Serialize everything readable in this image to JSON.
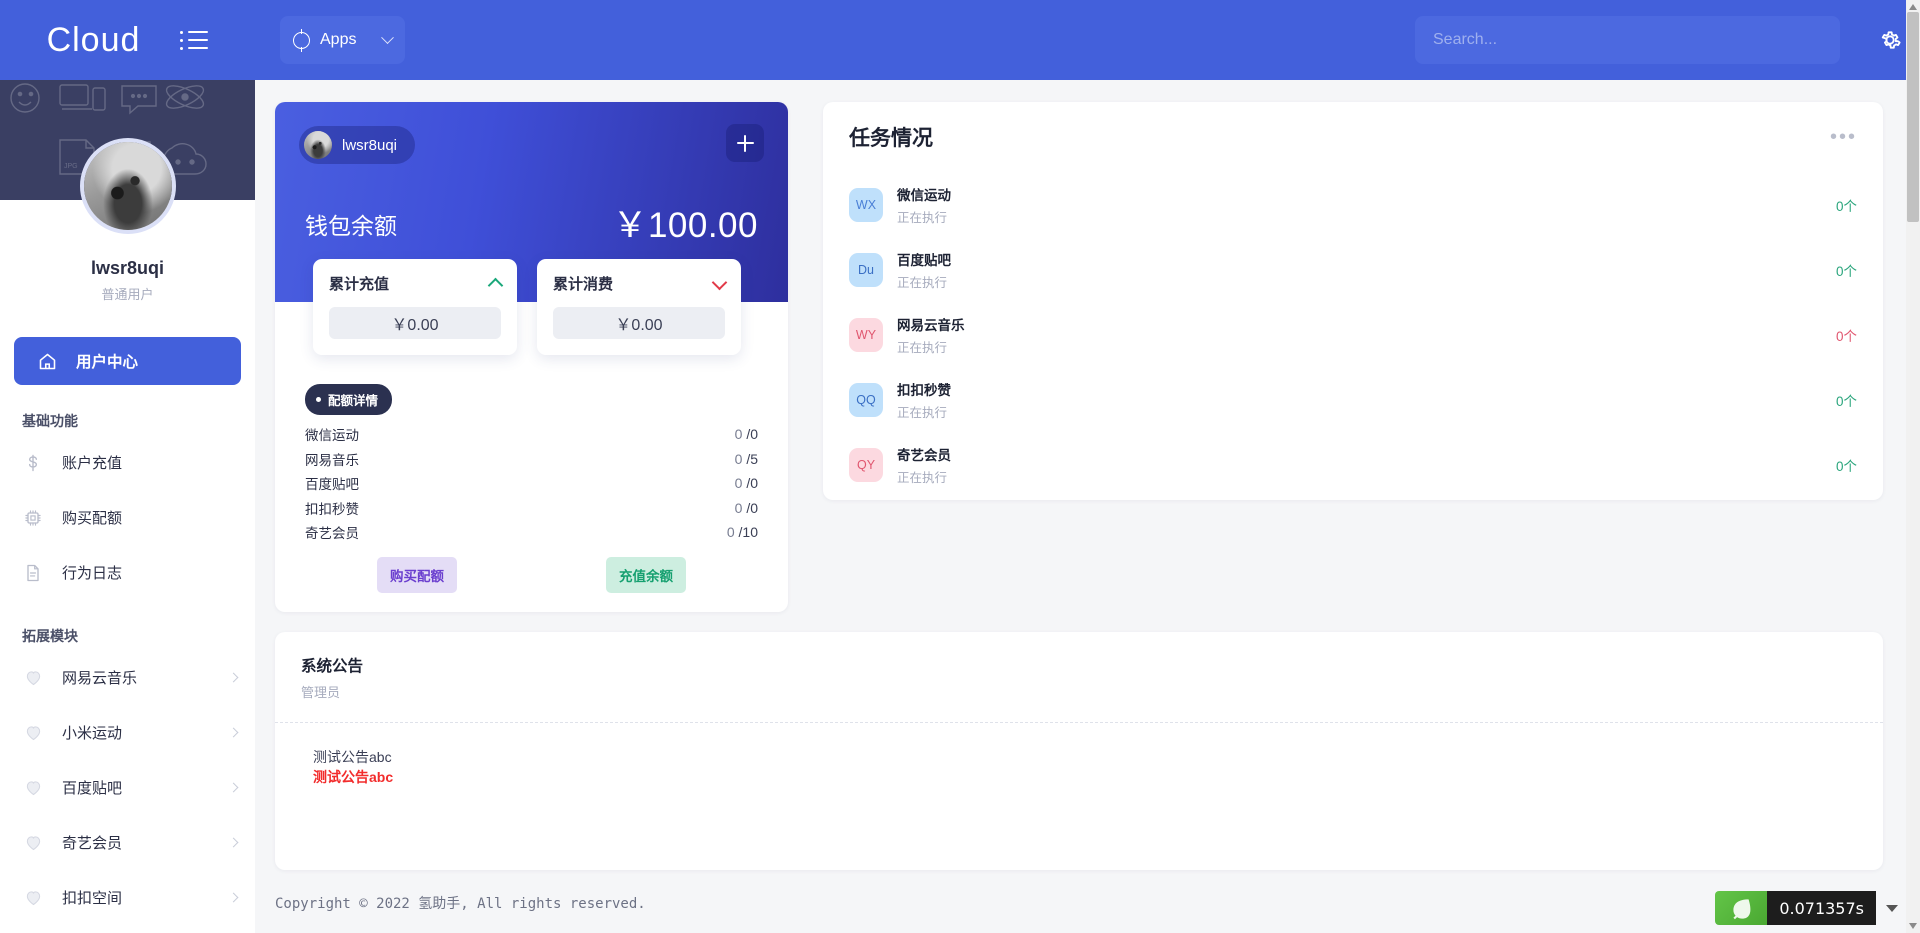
{
  "topbar": {
    "brand": "Cloud",
    "apps_label": "Apps",
    "search_placeholder": "Search..."
  },
  "sidebar": {
    "profile": {
      "name": "lwsr8uqi",
      "role": "普通用户"
    },
    "active_item": {
      "label": "用户中心",
      "icon": "home-icon"
    },
    "groups": [
      {
        "title": "基础功能",
        "items": [
          {
            "label": "账户充值",
            "icon": "dollar-icon"
          },
          {
            "label": "购买配额",
            "icon": "chip-icon"
          },
          {
            "label": "行为日志",
            "icon": "document-icon"
          }
        ]
      },
      {
        "title": "拓展模块",
        "items": [
          {
            "label": "网易云音乐",
            "icon": "heart-icon"
          },
          {
            "label": "小米运动",
            "icon": "heart-icon"
          },
          {
            "label": "百度贴吧",
            "icon": "heart-icon"
          },
          {
            "label": "奇艺会员",
            "icon": "heart-icon"
          },
          {
            "label": "扣扣空间",
            "icon": "heart-icon"
          }
        ]
      }
    ]
  },
  "wallet": {
    "user_chip": "lwsr8uqi",
    "balance_label": "钱包余额",
    "balance_amount": "￥100.00",
    "stats": [
      {
        "title": "累计充值",
        "value": "￥0.00",
        "trend": "up"
      },
      {
        "title": "累计消费",
        "value": "￥0.00",
        "trend": "down"
      }
    ],
    "quota_badge": "配额详情",
    "quota_rows": [
      {
        "name": "微信运动",
        "used": "0",
        "total": "/0"
      },
      {
        "name": "网易音乐",
        "used": "0",
        "total": "/5"
      },
      {
        "name": "百度贴吧",
        "used": "0",
        "total": "/0"
      },
      {
        "name": "扣扣秒赞",
        "used": "0",
        "total": "/0"
      },
      {
        "name": "奇艺会员",
        "used": "0",
        "total": "/10"
      }
    ],
    "buy_quota_label": "购买配额",
    "recharge_label": "充值余额"
  },
  "tasks": {
    "title": "任务情况",
    "rows": [
      {
        "initials": "WX",
        "name": "微信运动",
        "status": "正在执行",
        "count": "0个",
        "bg": "#bfe0fb",
        "fg": "#4a7fd6",
        "count_color": "#2aa57c"
      },
      {
        "initials": "Du",
        "name": "百度贴吧",
        "status": "正在执行",
        "count": "0个",
        "bg": "#bfe0fb",
        "fg": "#3a6fc4",
        "count_color": "#2aa57c"
      },
      {
        "initials": "WY",
        "name": "网易云音乐",
        "status": "正在执行",
        "count": "0个",
        "bg": "#fcd9e0",
        "fg": "#e0566f",
        "count_color": "#e0566f"
      },
      {
        "initials": "QQ",
        "name": "扣扣秒赞",
        "status": "正在执行",
        "count": "0个",
        "bg": "#bfe0fb",
        "fg": "#3a6fc4",
        "count_color": "#2aa57c"
      },
      {
        "initials": "QY",
        "name": "奇艺会员",
        "status": "正在执行",
        "count": "0个",
        "bg": "#fcd9e0",
        "fg": "#e0566f",
        "count_color": "#2aa57c"
      }
    ]
  },
  "notice": {
    "title": "系统公告",
    "author": "管理员",
    "lines": [
      {
        "text": "测试公告abc",
        "highlight": false
      },
      {
        "text": "测试公告abc",
        "highlight": true
      }
    ]
  },
  "footer": {
    "copyright": "Copyright © 2022 氢助手, All rights reserved."
  },
  "debug_badge": {
    "time": "0.071357s"
  },
  "colors": {
    "accent": "#4360db",
    "card_gradient_start": "#4a5fe0",
    "card_gradient_end": "#2e2f9e",
    "notice_highlight": "#f22c2c"
  }
}
